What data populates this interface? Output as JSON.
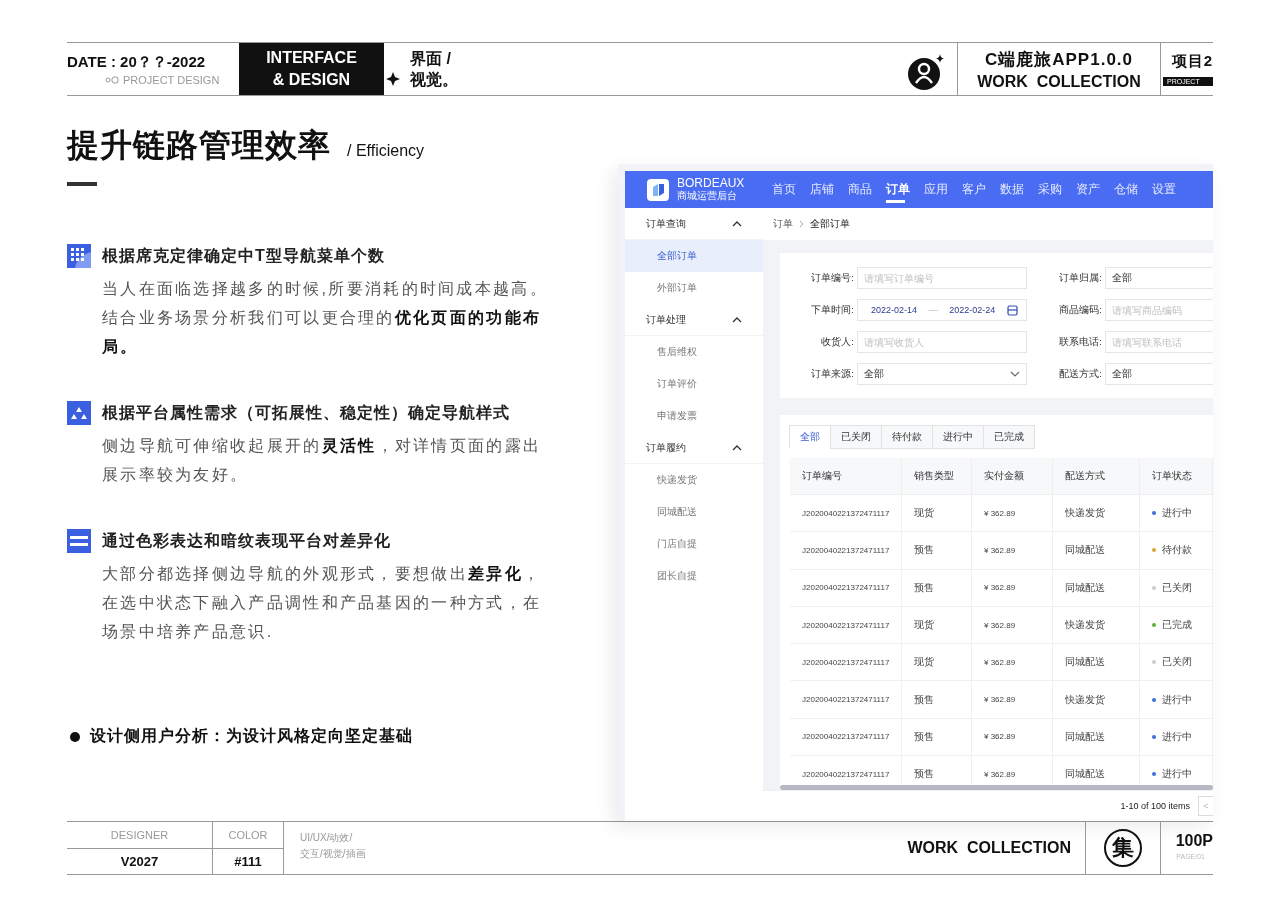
{
  "header": {
    "date": "DATE : 20？？-2022",
    "subtitle": "PROJECT DESIGN",
    "block": [
      "INTERFACE",
      "& DESIGN"
    ],
    "category": [
      "界面 /",
      "视觉。"
    ],
    "project": "C端鹿旅APP1.0.0",
    "collection": "WORK  COLLECTION",
    "project_no": "项目2",
    "project_tag": "PROJECT"
  },
  "title": "提升链路管理效率",
  "subtitle": "/ Efficiency",
  "points": [
    {
      "heading": "根据席克定律确定中T型导航菜单个数",
      "body": "当人在面临选择越多的时候,所要消耗的时间成本越高。结合业务场景分析我们可以更合理的**优化页面的功能布局。**"
    },
    {
      "heading": "根据平台属性需求（可拓展性、稳定性）确定导航样式",
      "body": "侧边导航可伸缩收起展开的**灵活性**，对详情页面的露出展示率较为友好。"
    },
    {
      "heading": "通过色彩表达和暗纹表现平台对差异化",
      "body": "大部分都选择侧边导航的外观形式，要想做出**差异化**，在选中状态下融入产品调性和产品基因的一种方式，在场景中培养产品意识."
    }
  ],
  "bullet": "设计侧用户分析：为设计风格定向坚定基础",
  "app": {
    "brand": "BORDEAUX",
    "brand_sub": "商城运营后台",
    "nav": [
      {
        "label": "首页",
        "selected": false
      },
      {
        "label": "店铺",
        "selected": false
      },
      {
        "label": "商品",
        "selected": false
      },
      {
        "label": "订单",
        "selected": true
      },
      {
        "label": "应用",
        "selected": false
      },
      {
        "label": "客户",
        "selected": false
      },
      {
        "label": "数据",
        "selected": false
      },
      {
        "label": "采购",
        "selected": false
      },
      {
        "label": "资产",
        "selected": false
      },
      {
        "label": "仓储",
        "selected": false
      },
      {
        "label": "设置",
        "selected": false
      }
    ],
    "sidebar": [
      {
        "label": "订单查询",
        "expanded": true,
        "children": [
          {
            "label": "全部订单",
            "selected": true
          },
          {
            "label": "外部订单",
            "selected": false
          }
        ]
      },
      {
        "label": "订单处理",
        "expanded": true,
        "children": [
          {
            "label": "售后维权",
            "selected": false
          },
          {
            "label": "订单评价",
            "selected": false
          },
          {
            "label": "申请发票",
            "selected": false
          }
        ]
      },
      {
        "label": "订单履约",
        "expanded": true,
        "children": [
          {
            "label": "快递发货",
            "selected": false
          },
          {
            "label": "同城配送",
            "selected": false
          },
          {
            "label": "门店自提",
            "selected": false
          },
          {
            "label": "团长自提",
            "selected": false
          }
        ]
      }
    ],
    "breadcrumb": [
      "订单",
      "全部订单"
    ],
    "filters": [
      {
        "label": "订单编号:",
        "kind": "text",
        "placeholder": "请填写订单编号"
      },
      {
        "label": "订单归属:",
        "kind": "value",
        "value": "全部"
      },
      {
        "label": "下单时间:",
        "kind": "date_range",
        "start": "2022-02-14",
        "separator": "—",
        "end": "2022-02-24"
      },
      {
        "label": "商品编码:",
        "kind": "text",
        "placeholder": "请填写商品编码"
      },
      {
        "label": "收货人:",
        "kind": "text",
        "placeholder": "请填写收货人"
      },
      {
        "label": "联系电话:",
        "kind": "text",
        "placeholder": "请填写联系电话"
      },
      {
        "label": "订单来源:",
        "kind": "select",
        "value": "全部"
      },
      {
        "label": "配送方式:",
        "kind": "value",
        "value": "全部"
      }
    ],
    "tabs": [
      {
        "label": "全部",
        "selected": true
      },
      {
        "label": "已关闭",
        "selected": false
      },
      {
        "label": "待付款",
        "selected": false
      },
      {
        "label": "进行中",
        "selected": false
      },
      {
        "label": "已完成",
        "selected": false
      }
    ],
    "table": {
      "columns": [
        "订单编号",
        "销售类型",
        "实付金额",
        "配送方式",
        "订单状态"
      ],
      "rows": [
        {
          "order_no": "J2020040221372471117",
          "type": "现货",
          "amount": "¥ 362.89",
          "delivery": "快递发货",
          "status": "进行中",
          "color": "#3d72d9"
        },
        {
          "order_no": "J2020040221372471117",
          "type": "预售",
          "amount": "¥ 362.89",
          "delivery": "同城配送",
          "status": "待付款",
          "color": "#d9a531"
        },
        {
          "order_no": "J2020040221372471117",
          "type": "预售",
          "amount": "¥ 362.89",
          "delivery": "同城配送",
          "status": "已关闭",
          "color": "#cccccc"
        },
        {
          "order_no": "J2020040221372471117",
          "type": "现货",
          "amount": "¥ 362.89",
          "delivery": "快递发货",
          "status": "已完成",
          "color": "#5fad3c"
        },
        {
          "order_no": "J2020040221372471117",
          "type": "现货",
          "amount": "¥ 362.89",
          "delivery": "同城配送",
          "status": "已关闭",
          "color": "#cccccc"
        },
        {
          "order_no": "J2020040221372471117",
          "type": "预售",
          "amount": "¥ 362.89",
          "delivery": "快递发货",
          "status": "进行中",
          "color": "#3d72d9"
        },
        {
          "order_no": "J2020040221372471117",
          "type": "预售",
          "amount": "¥ 362.89",
          "delivery": "同城配送",
          "status": "进行中",
          "color": "#3d72d9"
        },
        {
          "order_no": "J2020040221372471117",
          "type": "预售",
          "amount": "¥ 362.89",
          "delivery": "同城配送",
          "status": "进行中",
          "color": "#3d72d9"
        }
      ]
    },
    "pagination": "1-10 of 100 items",
    "pager_prev": "<"
  },
  "footer": {
    "designer_label": "DESIGNER",
    "designer": "V2027",
    "color_label": "COLOR",
    "color_code": "#111",
    "tags": [
      "UI/UX/动效/",
      "交互/视觉/插画"
    ],
    "collection": "WORK  COLLECTION",
    "logo": "集",
    "pages": "100P",
    "page": "PAGE/01"
  }
}
